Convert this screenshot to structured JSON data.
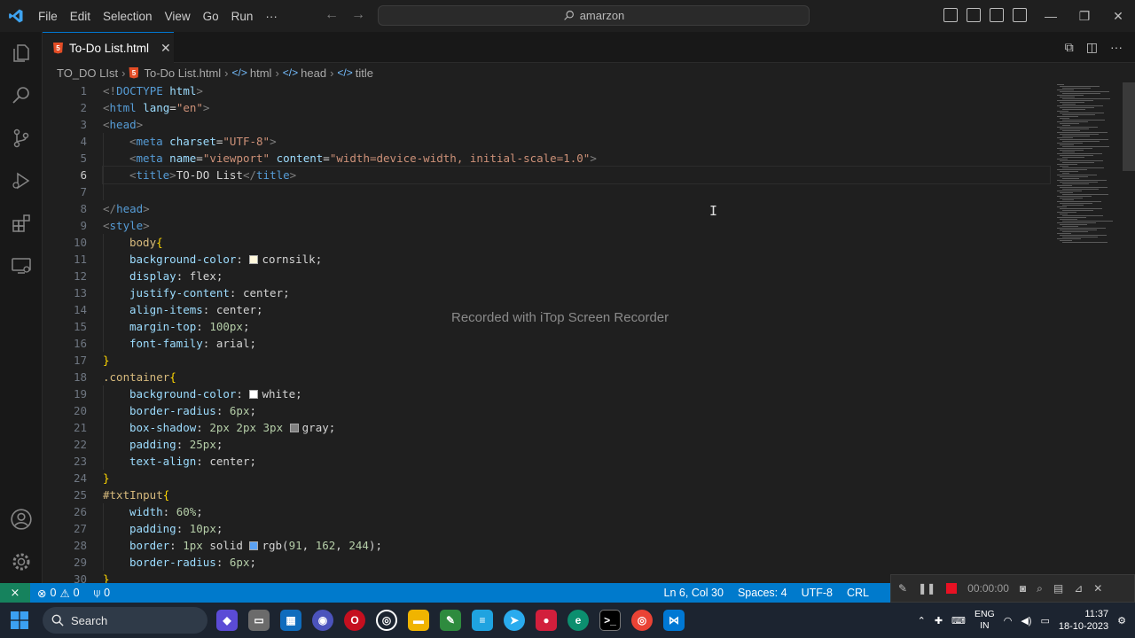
{
  "titlebar": {
    "menu": [
      "File",
      "Edit",
      "Selection",
      "View",
      "Go",
      "Run",
      "···"
    ],
    "search_text": "amarzon"
  },
  "tab": {
    "filename": "To-Do List.html",
    "close_glyph": "✕"
  },
  "breadcrumb": {
    "folder": "TO_DO LIst",
    "file": "To-Do List.html",
    "items": [
      "html",
      "head",
      "title"
    ]
  },
  "editor": {
    "line_numbers": [
      "1",
      "2",
      "3",
      "4",
      "5",
      "6",
      "7",
      "8",
      "9",
      "10",
      "11",
      "12",
      "13",
      "14",
      "15",
      "16",
      "17",
      "18",
      "19",
      "20",
      "21",
      "22",
      "23",
      "24",
      "25",
      "26",
      "27",
      "28",
      "29",
      "30"
    ],
    "active_line": 6,
    "lines": [
      [
        {
          "c": "t-tag",
          "t": "<!"
        },
        {
          "c": "t-el",
          "t": "DOCTYPE"
        },
        {
          "c": "t-txt",
          "t": " "
        },
        {
          "c": "t-attr",
          "t": "html"
        },
        {
          "c": "t-tag",
          "t": ">"
        }
      ],
      [
        {
          "c": "t-tag",
          "t": "<"
        },
        {
          "c": "t-el",
          "t": "html"
        },
        {
          "c": "t-txt",
          "t": " "
        },
        {
          "c": "t-attr",
          "t": "lang"
        },
        {
          "c": "t-txt",
          "t": "="
        },
        {
          "c": "t-str",
          "t": "\"en\""
        },
        {
          "c": "t-tag",
          "t": ">"
        }
      ],
      [
        {
          "c": "t-tag",
          "t": "<"
        },
        {
          "c": "t-el",
          "t": "head"
        },
        {
          "c": "t-tag",
          "t": ">"
        }
      ],
      [
        {
          "i": 1
        },
        {
          "c": "t-tag",
          "t": "<"
        },
        {
          "c": "t-el",
          "t": "meta"
        },
        {
          "c": "t-txt",
          "t": " "
        },
        {
          "c": "t-attr",
          "t": "charset"
        },
        {
          "c": "t-txt",
          "t": "="
        },
        {
          "c": "t-str",
          "t": "\"UTF-8\""
        },
        {
          "c": "t-tag",
          "t": ">"
        }
      ],
      [
        {
          "i": 1
        },
        {
          "c": "t-tag",
          "t": "<"
        },
        {
          "c": "t-el",
          "t": "meta"
        },
        {
          "c": "t-txt",
          "t": " "
        },
        {
          "c": "t-attr",
          "t": "name"
        },
        {
          "c": "t-txt",
          "t": "="
        },
        {
          "c": "t-str",
          "t": "\"viewport\""
        },
        {
          "c": "t-txt",
          "t": " "
        },
        {
          "c": "t-attr",
          "t": "content"
        },
        {
          "c": "t-txt",
          "t": "="
        },
        {
          "c": "t-str",
          "t": "\"width=device-width, initial-scale=1.0\""
        },
        {
          "c": "t-tag",
          "t": ">"
        }
      ],
      [
        {
          "i": 1
        },
        {
          "c": "t-tag",
          "t": "<"
        },
        {
          "c": "t-el",
          "t": "title"
        },
        {
          "c": "t-tag",
          "t": ">"
        },
        {
          "c": "t-txt",
          "t": "TO-DO List"
        },
        {
          "c": "t-tag",
          "t": "</"
        },
        {
          "c": "t-el",
          "t": "title"
        },
        {
          "c": "t-tag",
          "t": ">"
        }
      ],
      [
        {
          "i": 1
        }
      ],
      [
        {
          "c": "t-tag",
          "t": "</"
        },
        {
          "c": "t-el",
          "t": "head"
        },
        {
          "c": "t-tag",
          "t": ">"
        }
      ],
      [
        {
          "c": "t-tag",
          "t": "<"
        },
        {
          "c": "t-el",
          "t": "style"
        },
        {
          "c": "t-tag",
          "t": ">"
        }
      ],
      [
        {
          "i": 1
        },
        {
          "c": "t-sel",
          "t": "body"
        },
        {
          "c": "t-brace",
          "t": "{"
        }
      ],
      [
        {
          "i": 1
        },
        {
          "c": "t-prop",
          "t": "background-color"
        },
        {
          "c": "t-val",
          "t": ": "
        },
        {
          "sw": "#fff8dc"
        },
        {
          "c": "t-val",
          "t": "cornsilk;"
        }
      ],
      [
        {
          "i": 1
        },
        {
          "c": "t-prop",
          "t": "display"
        },
        {
          "c": "t-val",
          "t": ": flex;"
        }
      ],
      [
        {
          "i": 1
        },
        {
          "c": "t-prop",
          "t": "justify-content"
        },
        {
          "c": "t-val",
          "t": ": center;"
        }
      ],
      [
        {
          "i": 1
        },
        {
          "c": "t-prop",
          "t": "align-items"
        },
        {
          "c": "t-val",
          "t": ": center;"
        }
      ],
      [
        {
          "i": 1
        },
        {
          "c": "t-prop",
          "t": "margin-top"
        },
        {
          "c": "t-val",
          "t": ": "
        },
        {
          "c": "t-num",
          "t": "100px"
        },
        {
          "c": "t-val",
          "t": ";"
        }
      ],
      [
        {
          "i": 1
        },
        {
          "c": "t-prop",
          "t": "font-family"
        },
        {
          "c": "t-val",
          "t": ": arial;"
        }
      ],
      [
        {
          "c": "t-brace",
          "t": "}"
        }
      ],
      [
        {
          "c": "t-sel",
          "t": ".container"
        },
        {
          "c": "t-brace",
          "t": "{"
        }
      ],
      [
        {
          "i": 1
        },
        {
          "c": "t-prop",
          "t": "background-color"
        },
        {
          "c": "t-val",
          "t": ": "
        },
        {
          "sw": "#ffffff"
        },
        {
          "c": "t-val",
          "t": "white;"
        }
      ],
      [
        {
          "i": 1
        },
        {
          "c": "t-prop",
          "t": "border-radius"
        },
        {
          "c": "t-val",
          "t": ": "
        },
        {
          "c": "t-num",
          "t": "6px"
        },
        {
          "c": "t-val",
          "t": ";"
        }
      ],
      [
        {
          "i": 1
        },
        {
          "c": "t-prop",
          "t": "box-shadow"
        },
        {
          "c": "t-val",
          "t": ": "
        },
        {
          "c": "t-num",
          "t": "2px 2px 3px"
        },
        {
          "c": "t-val",
          "t": " "
        },
        {
          "sw": "#808080"
        },
        {
          "c": "t-val",
          "t": "gray;"
        }
      ],
      [
        {
          "i": 1
        },
        {
          "c": "t-prop",
          "t": "padding"
        },
        {
          "c": "t-val",
          "t": ": "
        },
        {
          "c": "t-num",
          "t": "25px"
        },
        {
          "c": "t-val",
          "t": ";"
        }
      ],
      [
        {
          "i": 1
        },
        {
          "c": "t-prop",
          "t": "text-align"
        },
        {
          "c": "t-val",
          "t": ": center;"
        }
      ],
      [
        {
          "c": "t-brace",
          "t": "}"
        }
      ],
      [
        {
          "c": "t-sel",
          "t": "#txtInput"
        },
        {
          "c": "t-brace",
          "t": "{"
        }
      ],
      [
        {
          "i": 1
        },
        {
          "c": "t-prop",
          "t": "width"
        },
        {
          "c": "t-val",
          "t": ": "
        },
        {
          "c": "t-num",
          "t": "60%"
        },
        {
          "c": "t-val",
          "t": ";"
        }
      ],
      [
        {
          "i": 1
        },
        {
          "c": "t-prop",
          "t": "padding"
        },
        {
          "c": "t-val",
          "t": ": "
        },
        {
          "c": "t-num",
          "t": "10px"
        },
        {
          "c": "t-val",
          "t": ";"
        }
      ],
      [
        {
          "i": 1
        },
        {
          "c": "t-prop",
          "t": "border"
        },
        {
          "c": "t-val",
          "t": ": "
        },
        {
          "c": "t-num",
          "t": "1px"
        },
        {
          "c": "t-val",
          "t": " solid "
        },
        {
          "sw": "#5ba2f4"
        },
        {
          "c": "t-val",
          "t": "rgb("
        },
        {
          "c": "t-num",
          "t": "91"
        },
        {
          "c": "t-val",
          "t": ", "
        },
        {
          "c": "t-num",
          "t": "162"
        },
        {
          "c": "t-val",
          "t": ", "
        },
        {
          "c": "t-num",
          "t": "244"
        },
        {
          "c": "t-val",
          "t": ");"
        }
      ],
      [
        {
          "i": 1
        },
        {
          "c": "t-prop",
          "t": "border-radius"
        },
        {
          "c": "t-val",
          "t": ": "
        },
        {
          "c": "t-num",
          "t": "6px"
        },
        {
          "c": "t-val",
          "t": ";"
        }
      ],
      [
        {
          "c": "t-brace",
          "t": "}"
        }
      ]
    ],
    "watermark": "Recorded with iTop Screen Recorder"
  },
  "statusbar": {
    "errors": "0",
    "warnings": "0",
    "ports": "0",
    "cursor_pos": "Ln 6, Col 30",
    "spaces": "Spaces: 4",
    "encoding": "UTF-8",
    "eol": "CRL"
  },
  "recorder": {
    "time": "00:00:00"
  },
  "taskbar": {
    "search_label": "Search",
    "lang_line1": "ENG",
    "lang_line2": "IN",
    "time": "11:37",
    "date": "18-10-2023"
  },
  "colors": {
    "accent": "#007acc",
    "remote": "#16825d",
    "record": "#e81123"
  }
}
